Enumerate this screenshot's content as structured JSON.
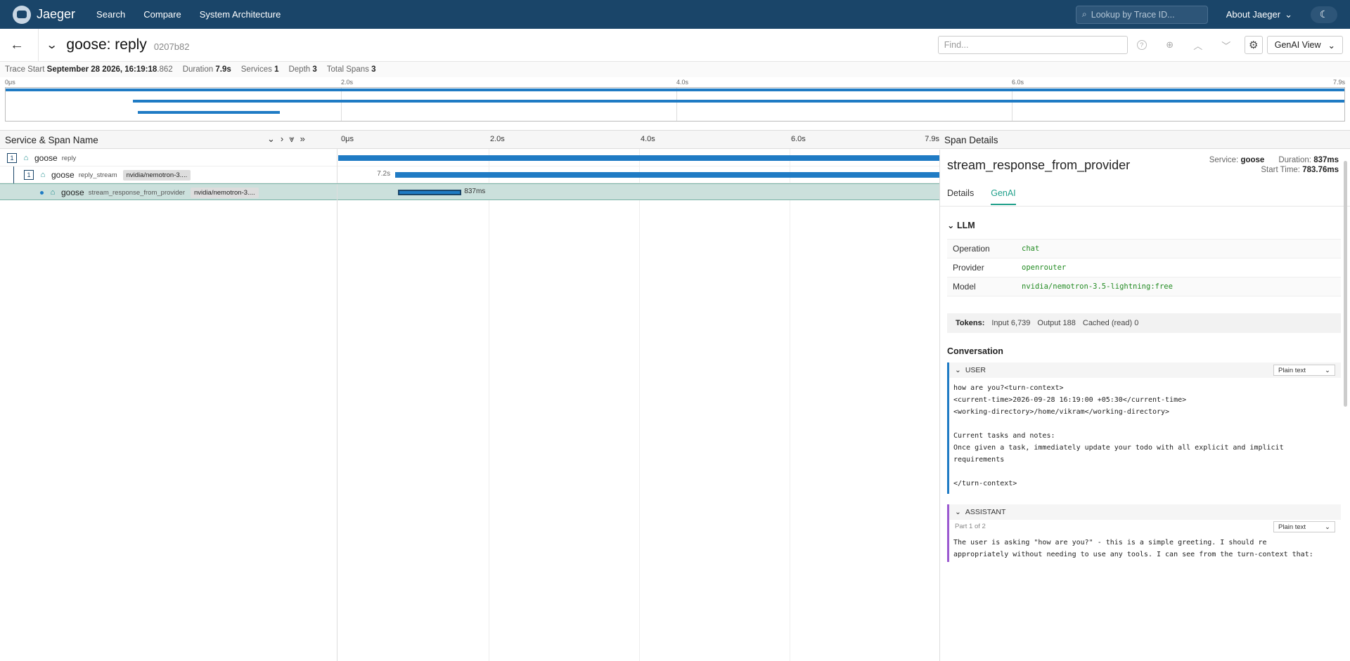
{
  "nav": {
    "brand": "Jaeger",
    "links": [
      "Search",
      "Compare",
      "System Architecture"
    ],
    "trace_lookup_placeholder": "Lookup by Trace ID...",
    "about": "About Jaeger"
  },
  "trace": {
    "title": "goose: reply",
    "id": "0207b82",
    "find_placeholder": "Find...",
    "view_mode": "GenAI View",
    "summary": {
      "start_label": "Trace Start",
      "start_value": "September 28 2026, 16:19:18",
      "start_ms": ".862",
      "duration_label": "Duration",
      "duration_value": "7.9s",
      "services_label": "Services",
      "services_value": "1",
      "depth_label": "Depth",
      "depth_value": "3",
      "spans_label": "Total Spans",
      "spans_value": "3"
    }
  },
  "minimap": {
    "ticks": [
      "0μs",
      "2.0s",
      "4.0s",
      "6.0s",
      "7.9s"
    ]
  },
  "timeline": {
    "service_span_header": "Service & Span Name",
    "ticks": [
      "0μs",
      "2.0s",
      "4.0s",
      "6.0s",
      "7.9s"
    ],
    "span_details_header": "Span Details",
    "rows": [
      {
        "count": "1",
        "service": "goose",
        "op": "reply",
        "tag": "",
        "label": "",
        "start": 0.0,
        "end": 1.0
      },
      {
        "count": "1",
        "service": "goose",
        "op": "reply_stream",
        "tag": "nvidia/nemotron-3....",
        "label": "7.2s",
        "start": 0.095,
        "end": 1.0
      },
      {
        "count": "",
        "service": "goose",
        "op": "stream_response_from_provider",
        "tag": "nvidia/nemotron-3....",
        "label": "837ms",
        "start": 0.099,
        "end": 0.205
      }
    ],
    "bar_color": "#1f7bc4"
  },
  "details": {
    "title": "stream_response_from_provider",
    "service_label": "Service:",
    "service_value": "goose",
    "duration_label": "Duration:",
    "duration_value": "837ms",
    "start_label": "Start Time:",
    "start_value": "783.76ms",
    "tabs": [
      "Details",
      "GenAI"
    ],
    "llm_title": "LLM",
    "kv": [
      {
        "k": "Operation",
        "v": "chat"
      },
      {
        "k": "Provider",
        "v": "openrouter"
      },
      {
        "k": "Model",
        "v": "nvidia/nemotron-3.5-lightning:free"
      }
    ],
    "tokens": {
      "label": "Tokens:",
      "input_label": "Input",
      "input_value": "6,739",
      "output_label": "Output",
      "output_value": "188",
      "cached_label": "Cached (read)",
      "cached_value": "0"
    },
    "conversation_title": "Conversation",
    "messages": [
      {
        "role": "USER",
        "part": "",
        "format": "Plain text",
        "text": "how are you?<turn-context>\n<current-time>2026-09-28 16:19:00 +05:30</current-time>\n<working-directory>/home/vikram</working-directory>\n\nCurrent tasks and notes:\nOnce given a task, immediately update your todo with all explicit and implicit\nrequirements\n\n</turn-context>"
      },
      {
        "role": "ASSISTANT",
        "part": "Part 1 of 2",
        "format": "Plain text",
        "text": "The user is asking \"how are you?\" - this is a simple greeting. I should re\nappropriately without needing to use any tools. I can see from the turn-context that:"
      }
    ]
  }
}
